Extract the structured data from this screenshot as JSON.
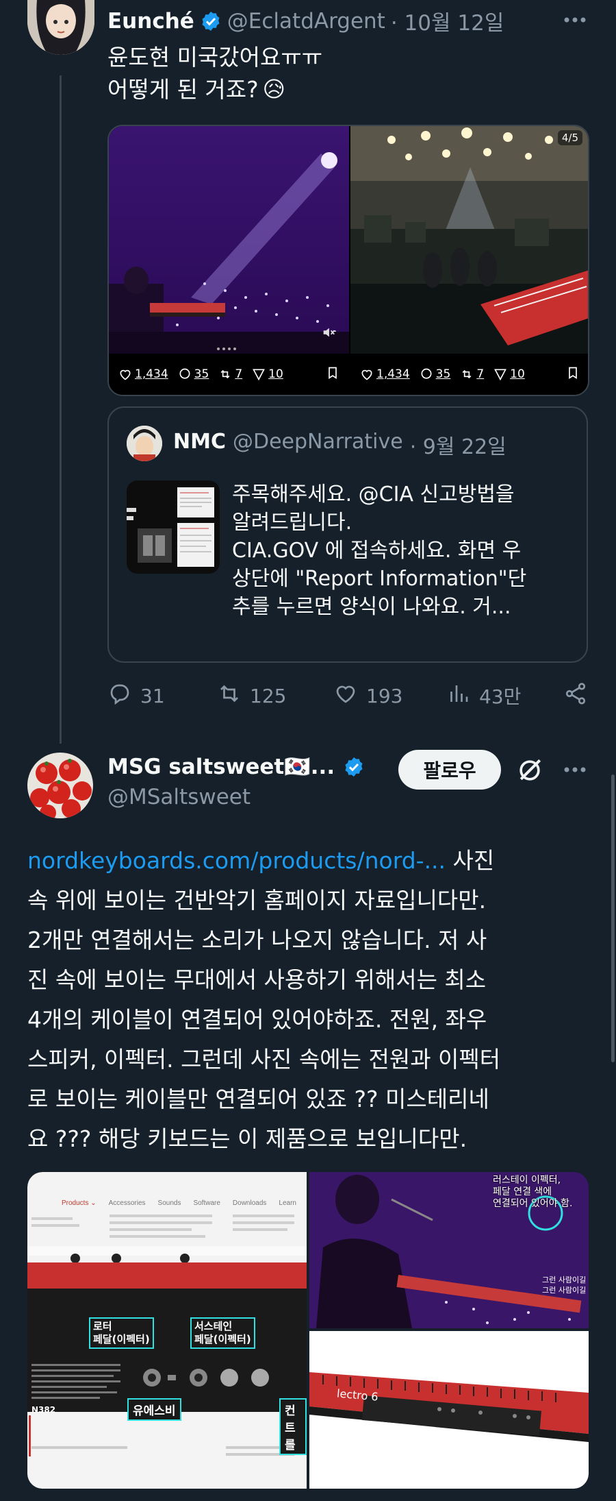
{
  "tweet1": {
    "display_name": "Eunché",
    "handle": "@EclatdArgent",
    "date": "· 10월 12일",
    "line1": "윤도현 미국갔어요ㅠㅠ",
    "line2": "어떻게 된 거죠?",
    "emoji": "😥",
    "media": {
      "left_stats": {
        "likes": "1,434",
        "replies": "35",
        "reposts": "7",
        "shares": "10"
      },
      "right_stats": {
        "likes": "1,434",
        "replies": "35",
        "reposts": "7",
        "shares": "10"
      },
      "counter": "4/5"
    },
    "quote": {
      "display_name": "NMC",
      "handle": "@DeepNarrative",
      "date": "· 9월 22일",
      "lines": [
        "주목해주세요. @CIA 신고방법을",
        "알려드립니다.",
        "CIA.GOV 에 접속하세요. 화면 우",
        "상단에 \"Report Information\"단",
        "추를 누르면 양식이 나와요. 거..."
      ]
    },
    "actions": {
      "replies": "31",
      "reposts": "125",
      "likes": "193",
      "views": "43만"
    }
  },
  "tweet2": {
    "display_name": "MSG saltsweet🇰🇷...",
    "handle": "@MSaltsweet",
    "follow_label": "팔로우",
    "link": "nordkeyboards.com/products/nord-...",
    "text_after_link": " 사진",
    "lines": [
      "속 위에 보이는 건반악기 홈페이지 자료입니다만.",
      "2개만 연결해서는 소리가 나오지 않습니다. 저 사",
      "진 속에 보이는 무대에서 사용하기 위해서는 최소",
      "4개의 케이블이 연결되어 있어야하죠. 전원, 좌우",
      "스피커, 이펙터. 그런데 사진 속에는 전원과 이펙터",
      "로 보이는 케이블만 연결되어 있죠 ?? 미스테리네",
      "요 ??? 해당 키보드는 이 제품으로 보입니다만."
    ],
    "media": {
      "nav_items": [
        "Products ⌄",
        "Accessories",
        "Sounds",
        "Software",
        "Downloads",
        "Learn"
      ],
      "annotation_rotary": "로터\n페달(이펙터)",
      "annotation_sustain": "서스테인\n페달(이펙터)",
      "annotation_usb": "유에스비",
      "annotation_control": "컨트롤",
      "model_label": "N382",
      "photo_caption_top": "러스테이 이펙터,\n페달 연결 색에\n연결되어 있어야 함.",
      "photo_caption_side": "그런 사람이길\n그런 사람이길",
      "keyboard_logo": "lectro 6"
    }
  },
  "colors": {
    "background": "#15202b",
    "accent": "#1d9bf0",
    "muted": "#8b98a5",
    "border": "#38444d"
  }
}
